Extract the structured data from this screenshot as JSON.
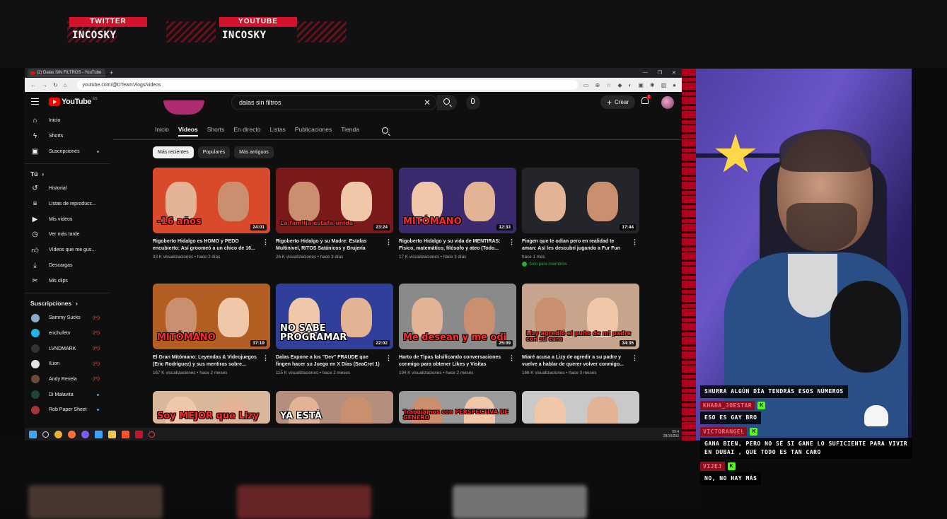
{
  "overlay": {
    "socials": [
      {
        "platform": "TWITTER",
        "handle": "INCOSKY"
      },
      {
        "platform": "YOUTUBE",
        "handle": "INCOSKY"
      }
    ]
  },
  "browser": {
    "tab_title": "(2) Dalas SIN FILTROS - YouTube",
    "new_tab": "+",
    "url": "youtube.com/@DTeamVlogs/videos",
    "window_controls": [
      "—",
      "❐",
      "✕"
    ]
  },
  "youtube": {
    "logo": "YouTube",
    "logo_region": "ES",
    "search_value": "dalas sin filtros",
    "create_label": "Crear",
    "notif_count": "2",
    "sidebar": {
      "main": [
        {
          "label": "Inicio",
          "icon": "home-icon"
        },
        {
          "label": "Shorts",
          "icon": "shorts-icon"
        },
        {
          "label": "Suscripciones",
          "icon": "subscriptions-icon"
        }
      ],
      "you_heading": "Tú",
      "you": [
        {
          "label": "Historial",
          "icon": "history-icon"
        },
        {
          "label": "Listas de reproducc...",
          "icon": "playlists-icon"
        },
        {
          "label": "Mis vídeos",
          "icon": "my-videos-icon"
        },
        {
          "label": "Ver más tarde",
          "icon": "watch-later-icon"
        },
        {
          "label": "Vídeos que me gus...",
          "icon": "liked-icon"
        },
        {
          "label": "Descargas",
          "icon": "download-icon"
        },
        {
          "label": "Mis clips",
          "icon": "clips-icon"
        }
      ],
      "subs_heading": "Suscripciones",
      "subs": [
        {
          "label": "Sammy Sucks",
          "color": "#8fa9c9",
          "status": "live"
        },
        {
          "label": "enchufetv",
          "color": "#1fb5e8",
          "status": "live"
        },
        {
          "label": "LVNDMARK",
          "color": "#333333",
          "status": "live"
        },
        {
          "label": "ILion",
          "color": "#e4e4e4",
          "status": "live"
        },
        {
          "label": "Andy Revela",
          "color": "#6b4b3b",
          "status": "live"
        },
        {
          "label": "Di Malavita",
          "color": "#224433",
          "status": "new"
        },
        {
          "label": "Rob Paper Sheet",
          "color": "#aa3333",
          "status": "new"
        }
      ]
    },
    "channel_tabs": [
      "Inicio",
      "Vídeos",
      "Shorts",
      "En directo",
      "Listas",
      "Publicaciones",
      "Tienda"
    ],
    "active_tab": "Vídeos",
    "chips": [
      "Más recientes",
      "Populares",
      "Más antiguos"
    ],
    "videos": [
      {
        "title": "Rigoberto Hidalgo es HOMO y PEDO encubierto: Así groomeó a un chico de 16...",
        "meta": "33 K visualizaciones • hace 2 días",
        "duration": "24:01",
        "caption": "-16 años",
        "bg": "#d94a2a"
      },
      {
        "title": "Rigoberto Hidalgo y su Madre: Estafas Multinivel, RITOS Satánicos y Brujería",
        "meta": "26 K visualizaciones • hace 3 días",
        "duration": "23:24",
        "caption": "La familia estafa unida",
        "bg": "#7a1a1a"
      },
      {
        "title": "Rigoberto Hidalgo y su vida de MENTIRAS: Físico, matemático, filósofo y ateo (Todo...",
        "meta": "17 K visualizaciones • hace 3 días",
        "duration": "12:33",
        "caption": "MITÓMANO",
        "bg": "#3b2a6e"
      },
      {
        "title": "Fingen que te odian pero en realidad te aman: Así les descubrí jugando a Fur Fun",
        "meta": "hace 1 mes",
        "duration": "17:44",
        "caption": "",
        "bg": "#23252b",
        "members": "Solo para miembros"
      },
      {
        "title": "El Gran Mitómano: Leyendas & Videojuegos (Eric Rodríguez) y sus mentiras sobre...",
        "meta": "167 K visualizaciones • hace 2 meses",
        "duration": "37:19",
        "caption": "MITÓMANO",
        "bg": "#b25d21"
      },
      {
        "title": "Dalas Expone a los \"Dev\" FRAUDE que fingen hacer su Juego en X Días (SeaCret 1)",
        "meta": "115 K visualizaciones • hace 2 meses",
        "duration": "22:02",
        "caption": "NO SABE PROGRAMAR",
        "bg": "#2f3f9a"
      },
      {
        "title": "Harto de Tipas falsificando conversaciones conmigo para obtener Likes y Visitas",
        "meta": "194 K visualizaciones • hace 2 meses",
        "duration": "25:09",
        "caption": "Me desean y me odi",
        "bg": "#8a8a8a"
      },
      {
        "title": "Miaré acusa a Lizy de agredir a su padre y vuelve a hablar de querer volver conmigo...",
        "meta": "166 K visualizaciones • hace 3 meses",
        "duration": "34:35",
        "caption": "Lizy agredió el puño de mi padre con su cara",
        "bg": "#c7a48c"
      },
      {
        "title": "",
        "meta": "",
        "duration": "",
        "caption": "Soy MEJOR que Lizy",
        "bg": "#d8b79a"
      },
      {
        "title": "",
        "meta": "",
        "duration": "",
        "caption": "YA ESTÁ",
        "bg": "#b58e7d"
      },
      {
        "title": "",
        "meta": "",
        "duration": "",
        "caption": "Trabajamos con PERSPECTIVA DE GÉNERO",
        "bg": "#9b9b9b"
      },
      {
        "title": "",
        "meta": "",
        "duration": "",
        "caption": "",
        "bg": "#c9c9c9"
      }
    ],
    "taskbar_clock": [
      "09:4",
      "28/10/202"
    ]
  },
  "chat": [
    {
      "type": "message",
      "text": "SHURRA ALGÚN DÍA TENDRÁS ESOS NÚMEROS"
    },
    {
      "type": "user",
      "text": "KHADA_JOESTAR"
    },
    {
      "type": "message",
      "text": "ESO ES GAY BRO"
    },
    {
      "type": "user",
      "text": "VICTORANGEL"
    },
    {
      "type": "message",
      "text": "GANA BIEN, PERO NO SÉ SI GANE LO SUFICIENTE PARA VIVIR EN DUBAI , QUE TODO ES TAN CARO"
    },
    {
      "type": "user",
      "text": "VIJEJ"
    },
    {
      "type": "message",
      "text": "NO, NO HAY MÁS"
    }
  ],
  "colors": {
    "accent": "#ff0000",
    "stream_red": "#d4122b",
    "kick_green": "#53fc18"
  }
}
